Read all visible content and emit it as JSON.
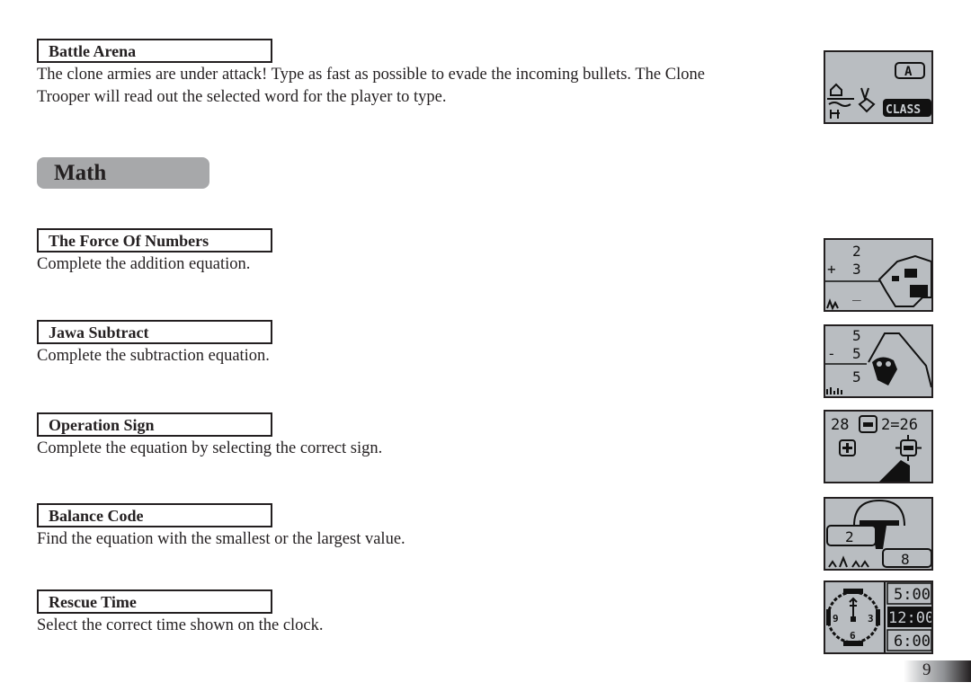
{
  "games_top": [
    {
      "title": "Battle Arena",
      "description": "The clone armies are under attack! Type as fast as possible to evade the incoming bullets. The Clone Trooper will read out the selected word for the player to type.",
      "screen": {
        "letter": "A",
        "word": "CLASS"
      }
    }
  ],
  "section": {
    "title": "Math"
  },
  "games": [
    {
      "title": "The Force Of Numbers",
      "description": "Complete the addition equation.",
      "screen": {
        "operand1": "2",
        "operator": "+",
        "operand2": "3",
        "answer": "_"
      }
    },
    {
      "title": "Jawa Subtract",
      "description": "Complete the subtraction equation.",
      "screen": {
        "operand1": "5",
        "operator": "-",
        "operand2": "5",
        "answer": "5"
      }
    },
    {
      "title": "Operation Sign",
      "description": "Complete the equation by selecting the correct sign.",
      "screen": {
        "left": "28",
        "sign": "-",
        "right": "2=26",
        "option_plus": "+",
        "option_minus": "-"
      }
    },
    {
      "title": "Balance Code",
      "description": "Find the equation with the smallest or the largest value.",
      "screen": {
        "value_left": "2",
        "value_right": "8"
      }
    },
    {
      "title": "Rescue Time",
      "description": "Select the correct time shown on the clock.",
      "screen": {
        "clock_9": "9",
        "clock_3": "3",
        "clock_6": "6",
        "options": [
          "5:00",
          "12:00",
          "6:00"
        ],
        "selected": "12:00"
      }
    }
  ],
  "page_number": "9"
}
